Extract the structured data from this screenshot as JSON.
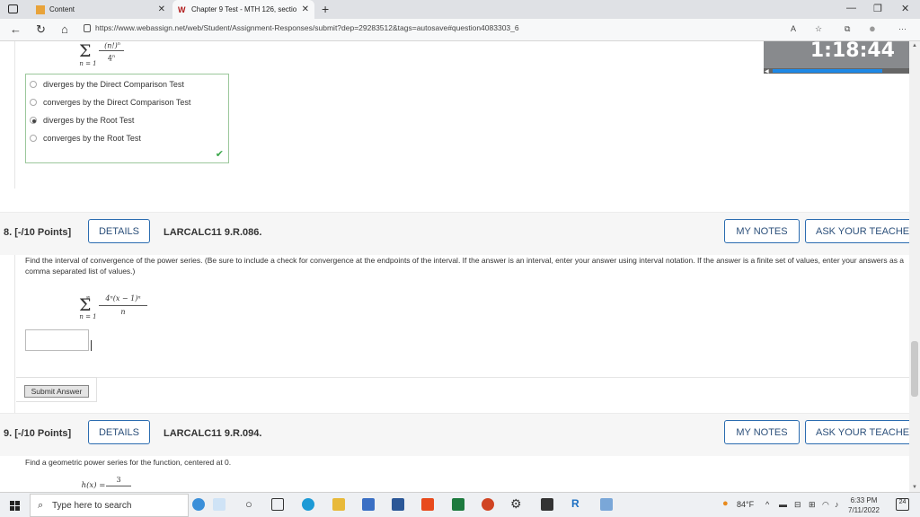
{
  "browser": {
    "tabs": [
      {
        "label": "Content"
      },
      {
        "label": "Chapter 9 Test - MTH 126, sectio"
      }
    ],
    "url": "https://www.webassign.net/web/Student/Assignment-Responses/submit?dep=29283512&tags=autosave#question4083303_6"
  },
  "timer": {
    "value": "1:18:44",
    "progress": 0.75
  },
  "prev_question": {
    "series_numerator": "(n!)",
    "series_exponent": "n",
    "series_denominator": "4",
    "series_den_exponent": "n",
    "index": "n = 1",
    "choices": [
      {
        "label": "diverges by the Direct Comparison Test",
        "selected": false
      },
      {
        "label": "converges by the Direct Comparison Test",
        "selected": false
      },
      {
        "label": "diverges by the Root Test",
        "selected": true
      },
      {
        "label": "converges by the Root Test",
        "selected": false
      }
    ]
  },
  "q8": {
    "number": "8.  [-/10 Points]",
    "details": "DETAILS",
    "code": "LARCALC11 9.R.086.",
    "notes": "MY NOTES",
    "teacher": "ASK YOUR TEACHER",
    "prompt": "Find the interval of convergence of the power series. (Be sure to include a check for convergence at the endpoints of the interval. If the answer is an interval, enter your answer using interval notation. If the answer is a finite set of values, enter your answers as a comma separated list of values.)",
    "numerator": "4ⁿ(x − 1)ⁿ",
    "denominator": "n",
    "upper": "∞",
    "index": "n = 1",
    "answer_value": "",
    "submit": "Submit Answer"
  },
  "q9": {
    "number": "9.  [-/10 Points]",
    "details": "DETAILS",
    "code": "LARCALC11 9.R.094.",
    "notes": "MY NOTES",
    "teacher": "ASK YOUR TEACHER",
    "prompt": "Find a geometric power series for the function, centered at 0.",
    "function_lhs": "h(x) =",
    "function_num": "3"
  },
  "taskbar": {
    "search_placeholder": "Type here to search",
    "weather": "84°F",
    "time": "6:33 PM",
    "date": "7/11/2022",
    "notifications": "24"
  }
}
